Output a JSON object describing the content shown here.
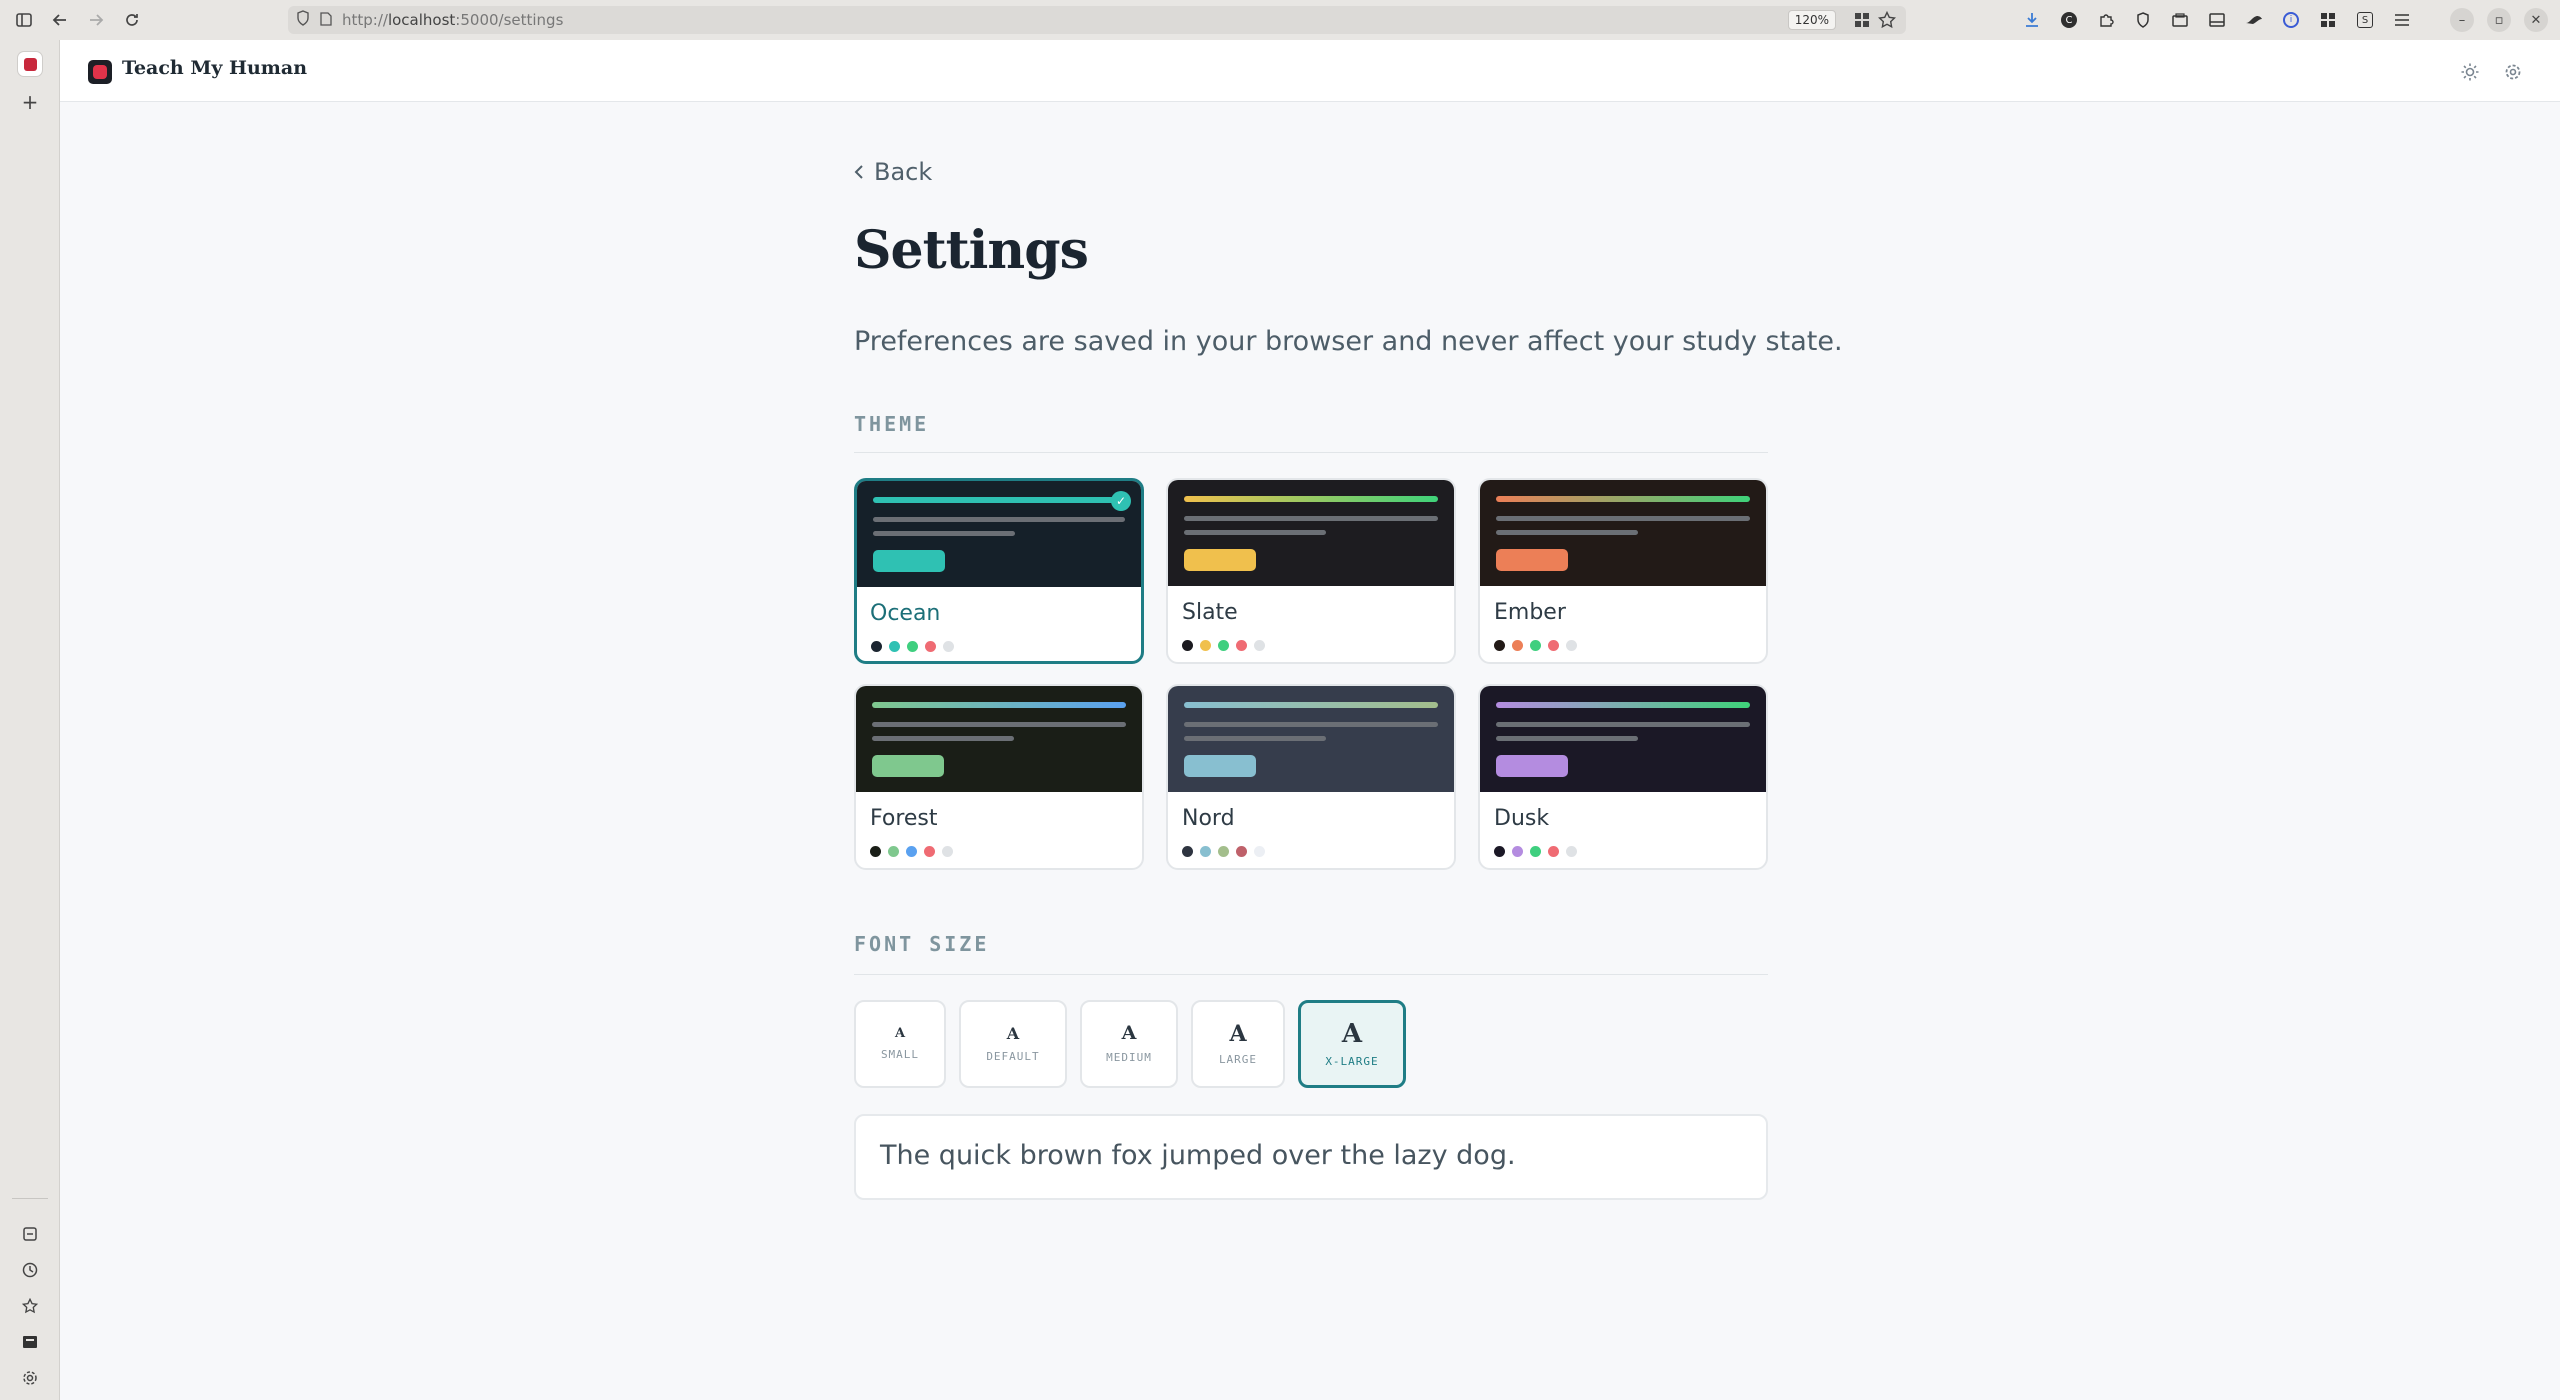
{
  "browser": {
    "url_prefix": "http://",
    "url_host": "localhost",
    "url_path": ":5000/settings",
    "zoom": "120%"
  },
  "app": {
    "brand": "Teach My Human"
  },
  "page": {
    "back_label": "Back",
    "title": "Settings",
    "subtitle": "Preferences are saved in your browser and never affect your study state.",
    "theme_section": "THEME",
    "font_section": "FONT SIZE",
    "sample_text": "The quick brown fox jumped over the lazy dog."
  },
  "themes": [
    {
      "name": "Ocean",
      "selected": true,
      "bg": "#152029",
      "top": "#2fc1b3",
      "pill": "#2fc1b3",
      "dots": [
        "#1b2530",
        "#2fc1b3",
        "#3fcf7f",
        "#ef6b73",
        "#dfe2e5"
      ]
    },
    {
      "name": "Slate",
      "selected": false,
      "bg": "#1d1c20",
      "top": "#f0c04d",
      "top2": "#3fd27a",
      "pill": "#f0c04d",
      "dots": [
        "#1b1a1f",
        "#f0c04d",
        "#3fcf7f",
        "#ef6b73",
        "#dfe2e5"
      ]
    },
    {
      "name": "Ember",
      "selected": false,
      "bg": "#221a17",
      "top": "#ec7f57",
      "top2": "#3fd27a",
      "pill": "#ec7f57",
      "dots": [
        "#221a17",
        "#ec7f57",
        "#3fcf7f",
        "#ef6b73",
        "#dfe2e5"
      ]
    },
    {
      "name": "Forest",
      "selected": false,
      "bg": "#1a1e17",
      "top": "#7fc88e",
      "top2": "#5aa1f0",
      "pill": "#7fc88e",
      "dots": [
        "#1a1e17",
        "#7fc88e",
        "#5aa1f0",
        "#ef6b73",
        "#dfe2e5"
      ]
    },
    {
      "name": "Nord",
      "selected": false,
      "bg": "#363d4c",
      "top": "#88bfd0",
      "top2": "#a3be8c",
      "pill": "#88bfd0",
      "dots": [
        "#2e3440",
        "#88bfd0",
        "#a3be8c",
        "#bf616a",
        "#eceff4"
      ]
    },
    {
      "name": "Dusk",
      "selected": false,
      "bg": "#1b1826",
      "top": "#b48ce0",
      "top2": "#3fd27a",
      "pill": "#b48ce0",
      "dots": [
        "#1b1826",
        "#b48ce0",
        "#3fcf7f",
        "#ef6b73",
        "#dfe2e5"
      ]
    }
  ],
  "font_sizes": [
    {
      "label": "SMALL",
      "glyph": "A",
      "selected": false
    },
    {
      "label": "DEFAULT",
      "glyph": "A",
      "selected": false
    },
    {
      "label": "MEDIUM",
      "glyph": "A",
      "selected": false
    },
    {
      "label": "LARGE",
      "glyph": "A",
      "selected": false
    },
    {
      "label": "X-LARGE",
      "glyph": "A",
      "selected": true
    }
  ]
}
